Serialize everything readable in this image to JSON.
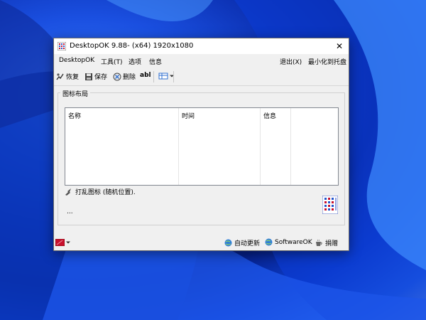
{
  "window": {
    "title": "DesktopOK 9.88- (x64) 1920x1080",
    "close_glyph": "✕"
  },
  "menu": {
    "left": [
      "DesktopOK",
      "工具(T)",
      "选项",
      "信息"
    ],
    "exit": "退出(X)",
    "minimize_tray": "最小化到托盘"
  },
  "toolbar": {
    "restore": "恢复",
    "save": "保存",
    "delete": "删除",
    "rename_glyph": "abl"
  },
  "group": {
    "title": "图标布局",
    "columns": [
      "名称",
      "时间",
      "信息"
    ],
    "rows": []
  },
  "shuffle": {
    "label": "打乱图标 (随机位置)."
  },
  "ellipsis": "...",
  "statusbar": {
    "auto_update": "自动更新",
    "software_ok": "SoftwareOK",
    "donate": "捐赠"
  },
  "colors": {
    "accent_red": "#c8102e",
    "globe_blue": "#2f7fd8"
  }
}
